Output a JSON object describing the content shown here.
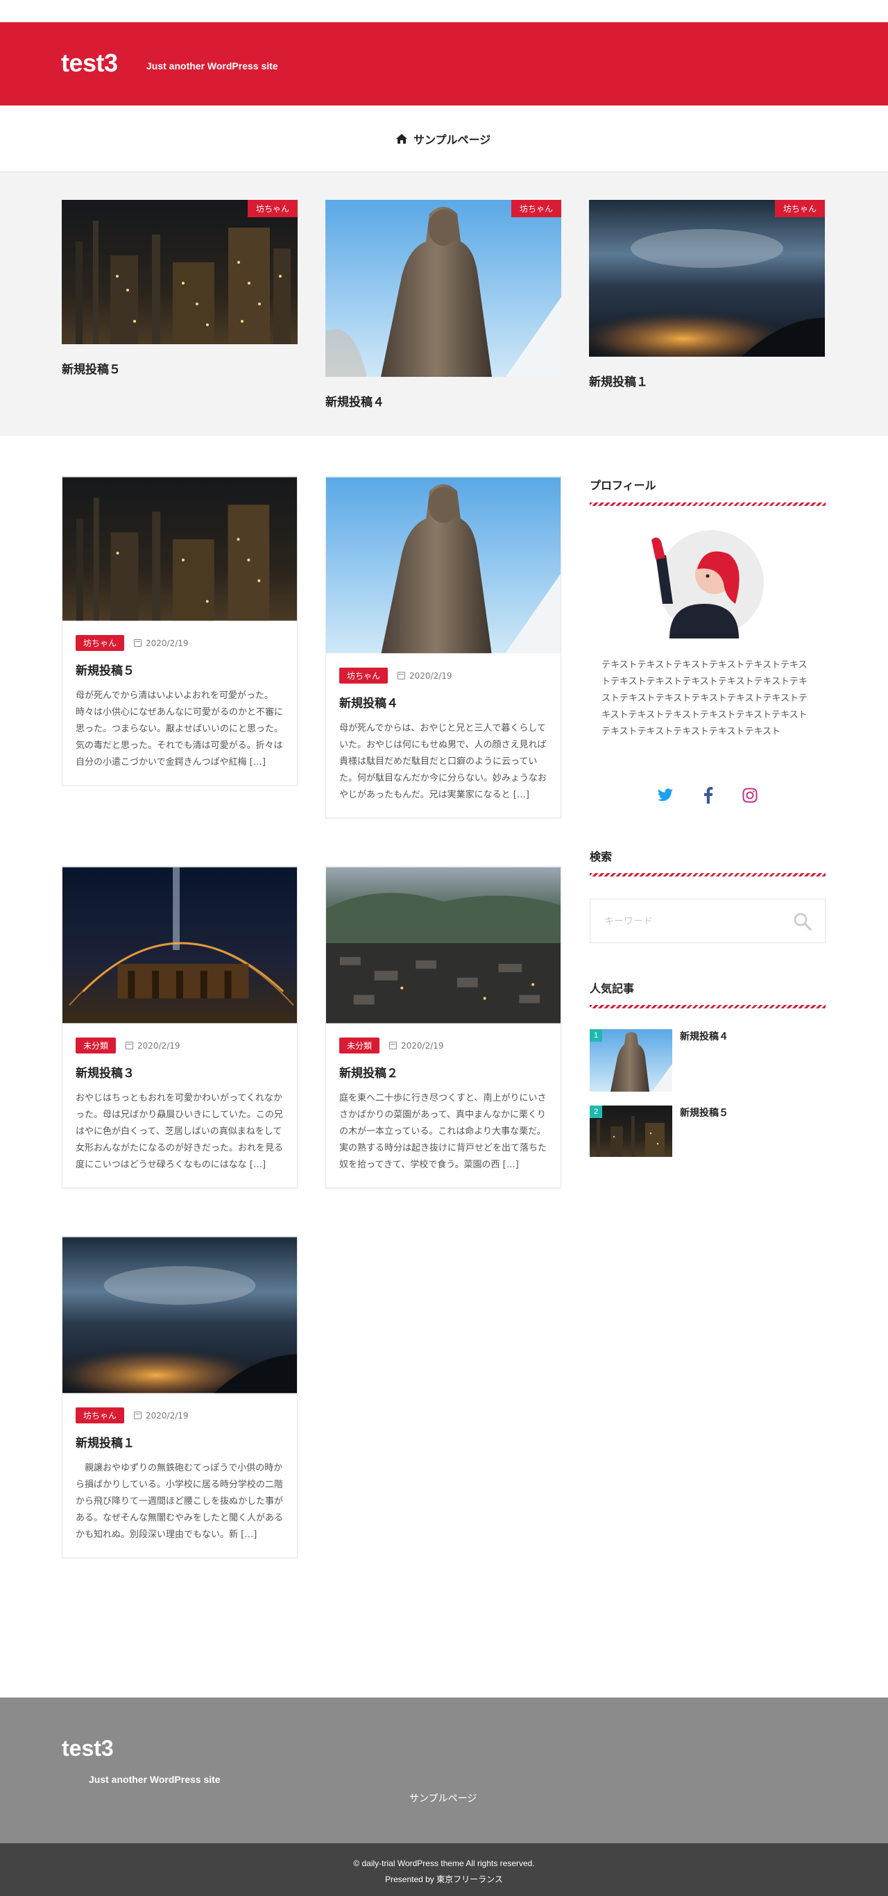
{
  "header": {
    "site_title": "test3",
    "tagline": "Just another WordPress site",
    "brand_color": "#d91c34"
  },
  "nav": {
    "home_icon": "home-icon",
    "items": [
      {
        "label": "サンプルページ"
      }
    ]
  },
  "featured": [
    {
      "title": "新規投稿５",
      "category": "坊ちゃん",
      "image": "factory-night"
    },
    {
      "title": "新規投稿４",
      "category": "坊ちゃん",
      "image": "statue"
    },
    {
      "title": "新規投稿１",
      "category": "坊ちゃん",
      "image": "city-lights"
    }
  ],
  "posts": [
    {
      "title": "新規投稿５",
      "category": "坊ちゃん",
      "date": "2020/2/19",
      "image": "factory-night",
      "excerpt": "母が死んでから清はいよいよおれを可愛がった。時々は小供心になぜあんなに可愛がるのかと不審に思った。つまらない。厭よせばいいのにと思った。気の毒だと思った。それでも清は可愛がる。折々は自分の小遣こづかいで金鍔きんつばや紅梅 […]"
    },
    {
      "title": "新規投稿４",
      "category": "坊ちゃん",
      "date": "2020/2/19",
      "image": "statue",
      "excerpt": "母が死んでからは、おやじと兄と三人で暮くらしていた。おやじは何にもせぬ男で、人の顔さえ見れば貴様は駄目だめだ駄目だと口癖のように云っていた。何が駄目なんだか今に分らない。妙みょうなおやじがあったもんだ。兄は実業家になると […]"
    },
    {
      "title": "新規投稿３",
      "category": "未分類",
      "date": "2020/2/19",
      "image": "light-painting",
      "excerpt": "おやじはちっともおれを可愛かわいがってくれなかった。母は兄ばかり贔屓ひいきにしていた。この兄はやに色が白くって、芝居しばいの真似まねをして女形おんながたになるのが好きだった。おれを見る度にこいつはどうせ碌ろくなものにはなな […]"
    },
    {
      "title": "新規投稿２",
      "category": "未分類",
      "date": "2020/2/19",
      "image": "village",
      "excerpt": "庭を東へ二十歩に行き尽つくすと、南上がりにいささかばかりの菜園があって、真中まんなかに栗くりの木が一本立っている。これは命より大事な栗だ。実の熟する時分は起き抜けに背戸せどを出て落ちた奴を拾ってきて、学校で食う。菜園の西 […]"
    },
    {
      "title": "新規投稿１",
      "category": "坊ちゃん",
      "date": "2020/2/19",
      "image": "city-lights",
      "excerpt": "　親譲おやゆずりの無鉄砲むてっぽうで小供の時から損ばかりしている。小学校に居る時分学校の二階から飛び降りて一週間ほど腰こしを抜ぬかした事がある。なぜそんな無闇むやみをしたと聞く人があるかも知れぬ。別段深い理由でもない。新 […]"
    }
  ],
  "sidebar": {
    "profile": {
      "title": "プロフィール",
      "text": "テキストテキストテキストテキストテキストテキストテキストテキストテキストテキストテキストテキストテキストテキストテキストテキストテキストテキストテキストテキストテキストテキストテキストテキストテキストテキストテキストテキスト",
      "social": [
        {
          "icon": "twitter-icon",
          "color": "#1da1f2"
        },
        {
          "icon": "facebook-icon",
          "color": "#3b5998"
        },
        {
          "icon": "instagram-icon",
          "color": "#c13584"
        }
      ]
    },
    "search": {
      "title": "検索",
      "placeholder": "キーワード"
    },
    "popular": {
      "title": "人気記事",
      "items": [
        {
          "rank": "1",
          "title": "新規投稿４",
          "image": "statue"
        },
        {
          "rank": "2",
          "title": "新規投稿５",
          "image": "factory-night"
        }
      ],
      "rank_color": "#22b8b0"
    }
  },
  "footer": {
    "site_title": "test3",
    "tagline": "Just another WordPress site",
    "nav_label": "サンプルページ",
    "copyright": "© daily-trial WordPress theme All rights reserved.",
    "presented": "Presented by 東京フリーランス"
  }
}
